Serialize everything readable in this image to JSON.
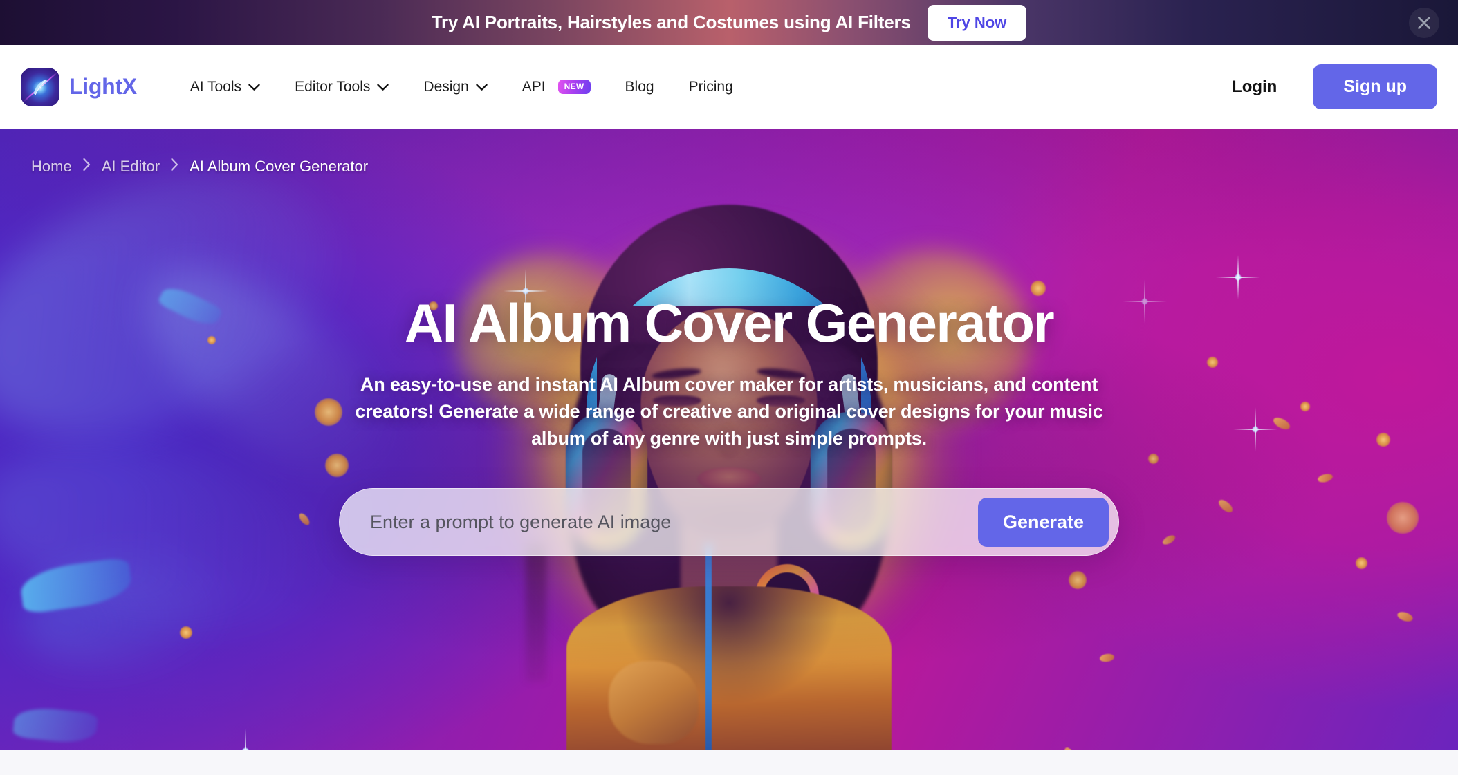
{
  "promo_banner": {
    "message": "Try AI Portraits, Hairstyles and Costumes using AI Filters",
    "cta_label": "Try Now",
    "close_icon": "close-icon"
  },
  "navbar": {
    "brand": {
      "name": "LightX",
      "logo_icon": "lightx-logo-icon",
      "brand_color": "#6366e8"
    },
    "links": [
      {
        "label": "AI Tools",
        "has_dropdown": true,
        "badge": null
      },
      {
        "label": "Editor Tools",
        "has_dropdown": true,
        "badge": null
      },
      {
        "label": "Design",
        "has_dropdown": true,
        "badge": null
      },
      {
        "label": "API",
        "has_dropdown": false,
        "badge": "NEW"
      },
      {
        "label": "Blog",
        "has_dropdown": false,
        "badge": null
      },
      {
        "label": "Pricing",
        "has_dropdown": false,
        "badge": null
      }
    ],
    "login_label": "Login",
    "signup_label": "Sign up",
    "signup_color": "#6366e8"
  },
  "hero": {
    "breadcrumb": [
      {
        "label": "Home",
        "current": false
      },
      {
        "label": "AI Editor",
        "current": false
      },
      {
        "label": "AI Album Cover Generator",
        "current": true
      }
    ],
    "breadcrumb_separator_icon": "chevron-right-icon",
    "title": "AI Album Cover Generator",
    "subtitle": "An easy-to-use and instant AI Album cover maker for artists, musicians, and content creators! Generate a wide range of creative and original cover designs for your music album of any genre with just simple prompts.",
    "prompt": {
      "placeholder": "Enter a prompt to generate AI image",
      "value": "",
      "button_label": "Generate",
      "button_color": "#6366e8"
    },
    "background_description": "Woman wearing headphones with eyes closed against a purple and magenta cosmic backdrop with a golden halo"
  }
}
